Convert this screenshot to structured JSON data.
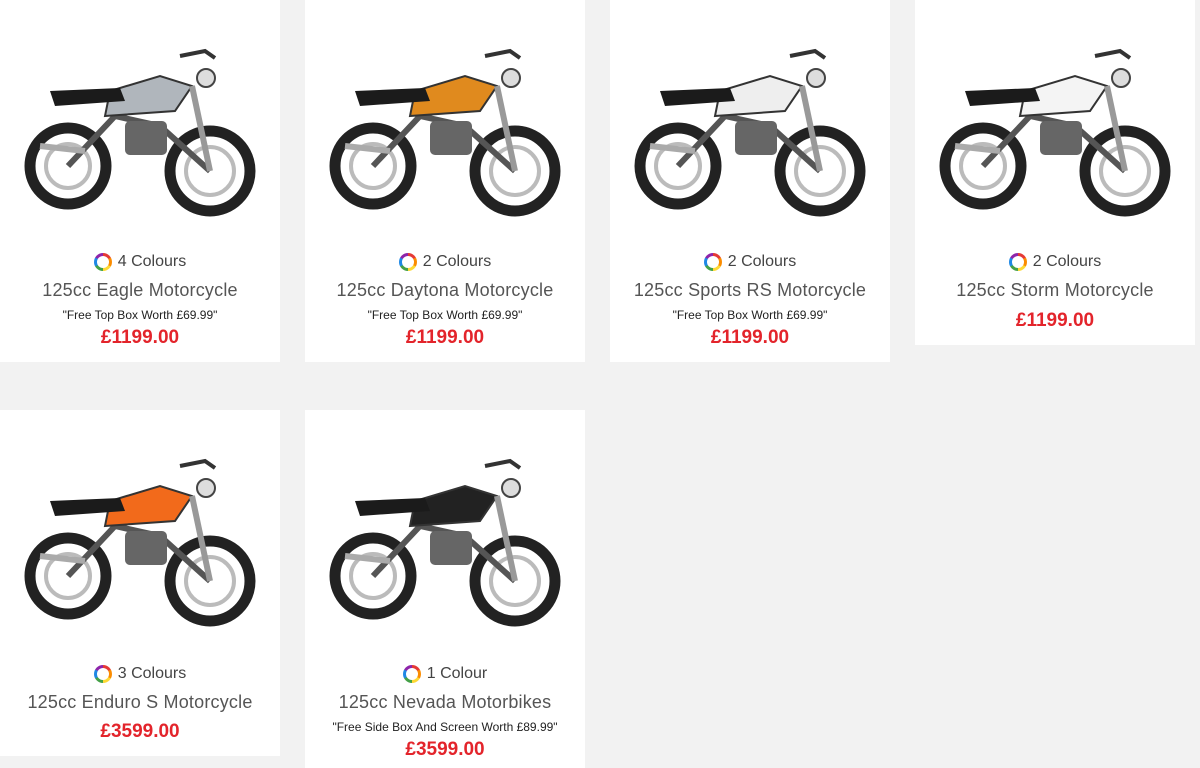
{
  "products": [
    {
      "colours": "4 Colours",
      "name": "125cc Eagle Motorcycle",
      "promo": "\"Free Top Box Worth £69.99\"",
      "price": "£1199.00",
      "body_color": "#b0b6bc",
      "image_icon": "motorcycle-icon"
    },
    {
      "colours": "2 Colours",
      "name": "125cc Daytona Motorcycle",
      "promo": "\"Free Top Box Worth £69.99\"",
      "price": "£1199.00",
      "body_color": "#e08a1e",
      "image_icon": "motorcycle-icon"
    },
    {
      "colours": "2 Colours",
      "name": "125cc Sports RS Motorcycle",
      "promo": "\"Free Top Box Worth £69.99\"",
      "price": "£1199.00",
      "body_color": "#eeeeee",
      "image_icon": "motorcycle-icon"
    },
    {
      "colours": "2 Colours",
      "name": "125cc Storm Motorcycle",
      "promo": "",
      "price": "£1199.00",
      "body_color": "#f4f4f4",
      "image_icon": "motorcycle-icon"
    },
    {
      "colours": "3 Colours",
      "name": "125cc Enduro S Motorcycle",
      "promo": "",
      "price": "£3599.00",
      "body_color": "#f26a1b",
      "image_icon": "motorcycle-icon"
    },
    {
      "colours": "1 Colour",
      "name": "125cc Nevada Motorbikes",
      "promo": "\"Free Side Box And Screen Worth £89.99\"",
      "price": "£3599.00",
      "body_color": "#222222",
      "image_icon": "motorcycle-icon"
    }
  ],
  "colors": {
    "price": "#e3242b",
    "background": "#f2f2f2",
    "card": "#ffffff"
  }
}
